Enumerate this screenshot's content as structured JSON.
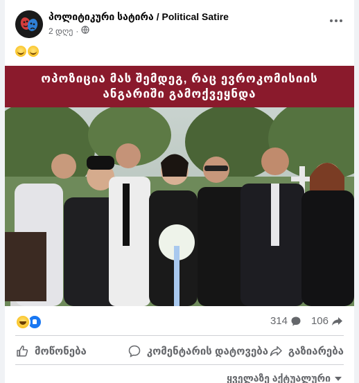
{
  "post": {
    "page_name": "პოლიტიკური სატირა / Political Satire",
    "time": "2 დღე",
    "separator": "·",
    "text_emojis": [
      "😁",
      "😁"
    ],
    "banner_line1": "ოპოზიცია მას შემდეგ, რაც ევროკომისიის",
    "banner_line2": "ანგარიში გამოქვეყნდა"
  },
  "stats": {
    "comments": "314",
    "shares": "106"
  },
  "actions": {
    "like": "მოწონება",
    "comment": "კომენტარის დატოვება",
    "share": "გაზიარება"
  },
  "sort": {
    "label": "ყველაზე აქტუალური"
  },
  "colors": {
    "banner": "#8a1a2c",
    "like_blue": "#1877f2",
    "secondary_text": "#65676b"
  }
}
